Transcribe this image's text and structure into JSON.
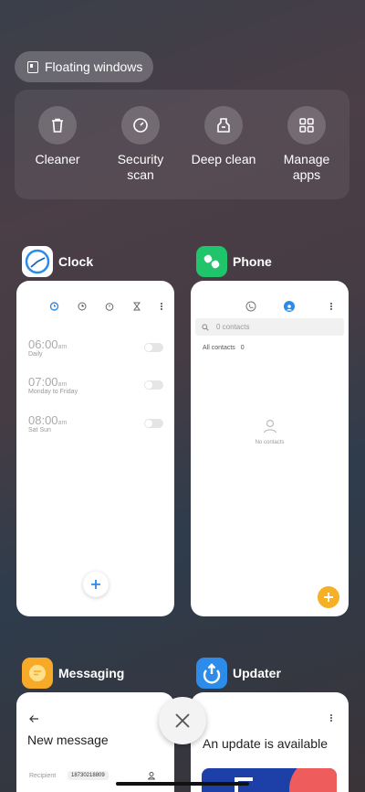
{
  "floating": {
    "label": "Floating windows",
    "icon": "floating-window-icon"
  },
  "tools": [
    {
      "label": "Cleaner",
      "icon": "trash-icon"
    },
    {
      "label": "Security\nscan",
      "icon": "security-scan-icon"
    },
    {
      "label": "Deep clean",
      "icon": "deep-clean-icon"
    },
    {
      "label": "Manage\napps",
      "icon": "grid-icon"
    }
  ],
  "clock": {
    "name": "Clock",
    "alarms": [
      {
        "time": "06:00",
        "ampm": "am",
        "repeat": "Daily"
      },
      {
        "time": "07:00",
        "ampm": "am",
        "repeat": "Monday to Friday"
      },
      {
        "time": "08:00",
        "ampm": "am",
        "repeat": "Sat Sun"
      }
    ],
    "colors": {
      "accent": "#2a8be8"
    }
  },
  "phone": {
    "name": "Phone",
    "search_placeholder": "0 contacts",
    "filter": "All contacts",
    "filter_count": "0",
    "empty_text": "No contacts",
    "colors": {
      "accent": "#2a8be8",
      "fab": "#f5b025",
      "icon": "#20c46a"
    }
  },
  "messaging": {
    "name": "Messaging",
    "title": "New message",
    "recipient_label": "Recipient",
    "recipient_value": "18730218809",
    "colors": {
      "icon": "#f7a928"
    }
  },
  "updater": {
    "name": "Updater",
    "title": "An update is available",
    "colors": {
      "icon": "#2d8be9",
      "banner_blue": "#1c3fa8",
      "banner_red": "#ee5c5c"
    }
  }
}
